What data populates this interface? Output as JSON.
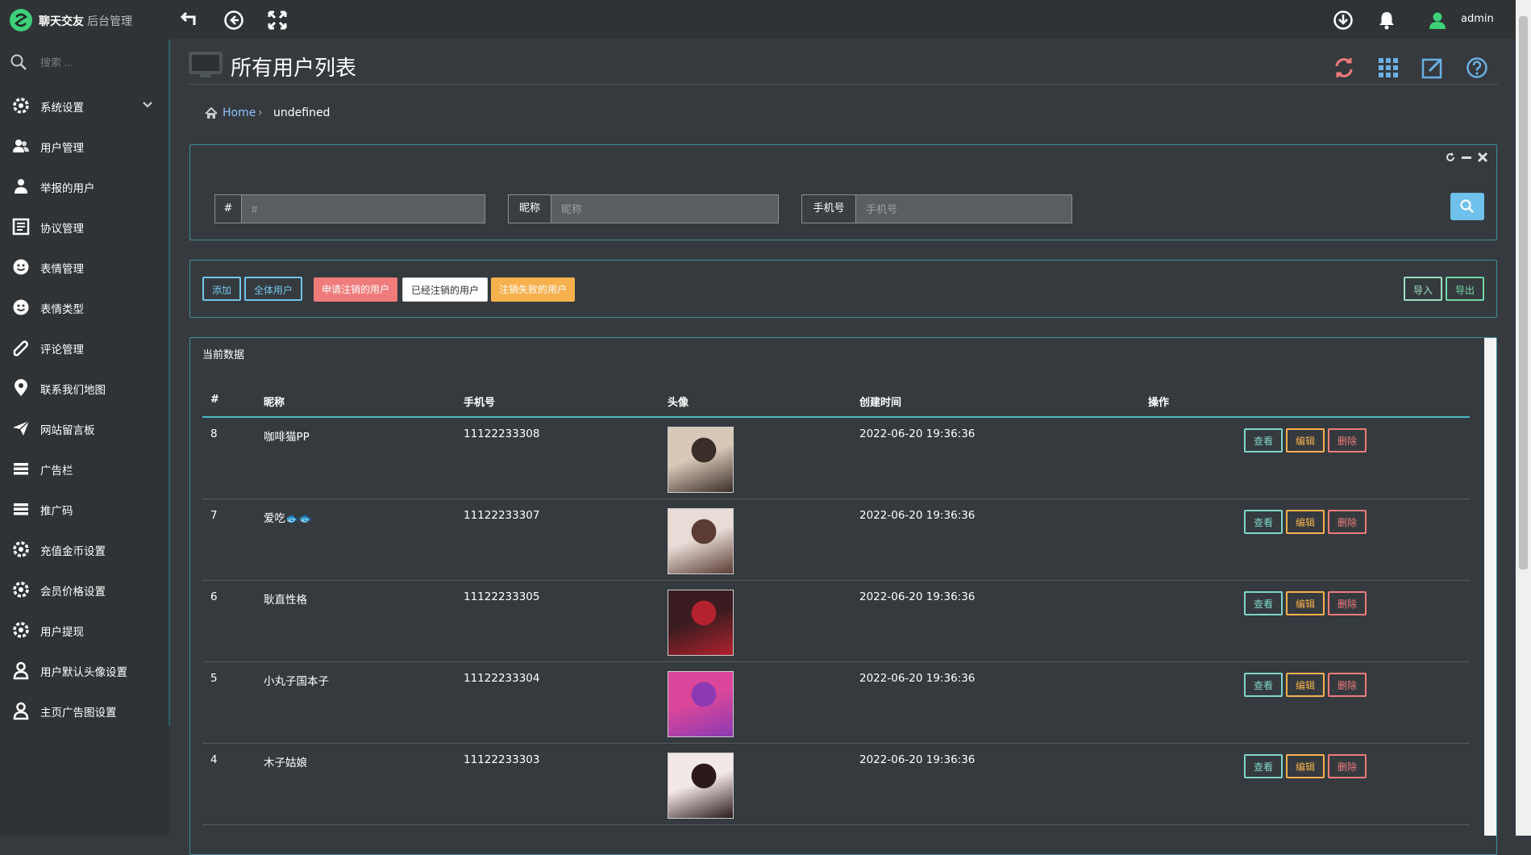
{
  "app": {
    "brand": "聊天交友",
    "brand_sub": "后台管理",
    "user": "admin"
  },
  "topbar_icons": [
    "back-arrow-icon",
    "circle-left-icon",
    "fullscreen-icon",
    "download-circle-icon",
    "bell-icon",
    "user-icon"
  ],
  "sidebar": {
    "search_placeholder": "搜索 ...",
    "items": [
      {
        "label": "系统设置",
        "icon": "gear-icon",
        "expandable": true
      },
      {
        "label": "用户管理",
        "icon": "users-icon"
      },
      {
        "label": "举报的用户",
        "icon": "user-report-icon"
      },
      {
        "label": "协议管理",
        "icon": "document-icon"
      },
      {
        "label": "表情管理",
        "icon": "smile-icon"
      },
      {
        "label": "表情类型",
        "icon": "smile-icon"
      },
      {
        "label": "评论管理",
        "icon": "comment-icon"
      },
      {
        "label": "联系我们地图",
        "icon": "map-pin-icon"
      },
      {
        "label": "网站留言板",
        "icon": "paper-plane-icon"
      },
      {
        "label": "广告栏",
        "icon": "list-icon"
      },
      {
        "label": "推广码",
        "icon": "list-icon"
      },
      {
        "label": "充值金币设置",
        "icon": "gear-icon"
      },
      {
        "label": "会员价格设置",
        "icon": "gear-icon"
      },
      {
        "label": "用户提现",
        "icon": "gear-icon"
      },
      {
        "label": "用户默认头像设置",
        "icon": "user-icon"
      },
      {
        "label": "主页广告图设置",
        "icon": "user-icon"
      }
    ]
  },
  "page": {
    "title": "所有用户列表",
    "breadcrumb": {
      "home": "Home",
      "separator": "›",
      "current": "undefined"
    },
    "header_tools": [
      "refresh-icon",
      "grid-icon",
      "edit-icon",
      "help-icon"
    ]
  },
  "filters": [
    {
      "label": "#",
      "placeholder": "#"
    },
    {
      "label": "昵称",
      "placeholder": "昵称"
    },
    {
      "label": "手机号",
      "placeholder": "手机号"
    }
  ],
  "toolbar": {
    "add": "添加",
    "all_users": "全体用户",
    "apply_cancel": "申请注销的用户",
    "cancelled": "已经注销的用户",
    "cancel_failed": "注销失败的用户",
    "import": "导入",
    "export": "导出"
  },
  "table": {
    "title": "当前数据",
    "columns": [
      "#",
      "昵称",
      "手机号",
      "头像",
      "创建时间",
      "操作"
    ],
    "actions": {
      "view": "查看",
      "edit": "编辑",
      "delete": "删除"
    },
    "rows": [
      {
        "id": "8",
        "nickname": "咖啡猫PP",
        "phone": "11122233308",
        "created": "2022-06-20 19:36:36",
        "avatar_colors": [
          "#d9c8b8",
          "#3a2e2a"
        ]
      },
      {
        "id": "7",
        "nickname": "爱吃🐟🐟",
        "phone": "11122233307",
        "created": "2022-06-20 19:36:36",
        "avatar_colors": [
          "#e8dcd6",
          "#5a3c34"
        ]
      },
      {
        "id": "6",
        "nickname": "耿直性格",
        "phone": "11122233305",
        "created": "2022-06-20 19:36:36",
        "avatar_colors": [
          "#3a1c20",
          "#b3222e"
        ]
      },
      {
        "id": "5",
        "nickname": "小丸子国本子",
        "phone": "11122233304",
        "created": "2022-06-20 19:36:36",
        "avatar_colors": [
          "#d9469a",
          "#8c3ab3"
        ]
      },
      {
        "id": "4",
        "nickname": "木子姑娘",
        "phone": "11122233303",
        "created": "2022-06-20 19:36:36",
        "avatar_colors": [
          "#f2e8e6",
          "#2a1a1a"
        ]
      }
    ]
  },
  "colors": {
    "accent": "#72c4ea",
    "danger": "#f07b7b",
    "warning": "#f6b04d",
    "success": "#70d7a6"
  }
}
